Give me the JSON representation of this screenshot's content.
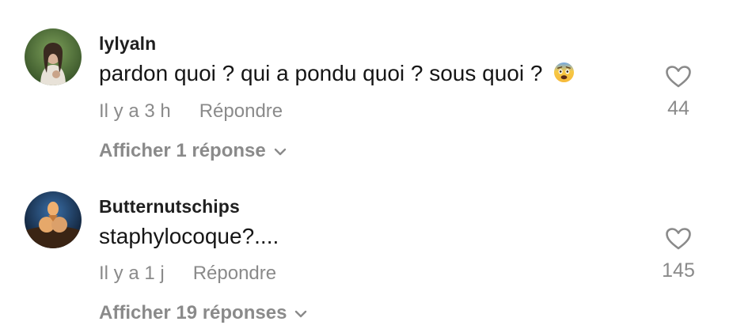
{
  "comments": [
    {
      "username": "lylyaln",
      "text": "pardon quoi ? qui a pondu quoi ? sous quoi ?",
      "emoji": "fearful-face-emoji",
      "time": "Il y a 3 h",
      "reply_label": "Répondre",
      "like_count": "44",
      "view_replies": "Afficher 1 réponse"
    },
    {
      "username": "Butternutschips",
      "text": "staphylocoque?....",
      "time": "Il y a 1 j",
      "reply_label": "Répondre",
      "like_count": "145",
      "view_replies": "Afficher 19 réponses"
    }
  ],
  "icons": {
    "like": "heart-outline-icon",
    "expand": "chevron-down-icon"
  },
  "colors": {
    "muted": "#8a8a8a",
    "text": "#161616"
  }
}
